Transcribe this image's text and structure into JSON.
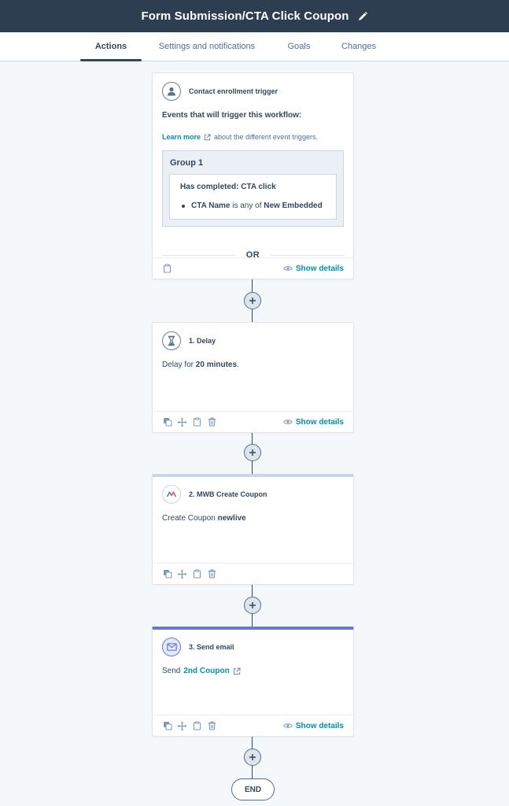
{
  "header": {
    "title": "Form Submission/CTA Click Coupon"
  },
  "tabs": [
    {
      "label": "Actions"
    },
    {
      "label": "Settings and notifications"
    },
    {
      "label": "Goals"
    },
    {
      "label": "Changes"
    }
  ],
  "trigger": {
    "title": "Contact enrollment trigger",
    "events_heading": "Events that will trigger this workflow:",
    "learn_more": "Learn more",
    "learn_more_suffix": "about the different event triggers.",
    "group_title": "Group 1",
    "filter_title": "Has completed: CTA click",
    "filter_property": "CTA Name",
    "filter_operator": "is any of",
    "filter_value": "New Embedded",
    "or_label": "OR",
    "show_details": "Show details"
  },
  "actions": [
    {
      "title": "1. Delay",
      "body_prefix": "Delay for",
      "body_value": "20 minutes",
      "body_suffix": ".",
      "show_details": "Show details"
    },
    {
      "title": "2. MWB Create Coupon",
      "body_prefix": "Create Coupon",
      "body_value": "newlive"
    },
    {
      "title": "3. Send email",
      "body_prefix": "Send",
      "body_value": "2nd Coupon",
      "show_details": "Show details"
    }
  ],
  "end_label": "END",
  "colors": {
    "header_bg": "#2d3e50",
    "link": "#0091ae",
    "email_accent": "#6a78d1"
  }
}
